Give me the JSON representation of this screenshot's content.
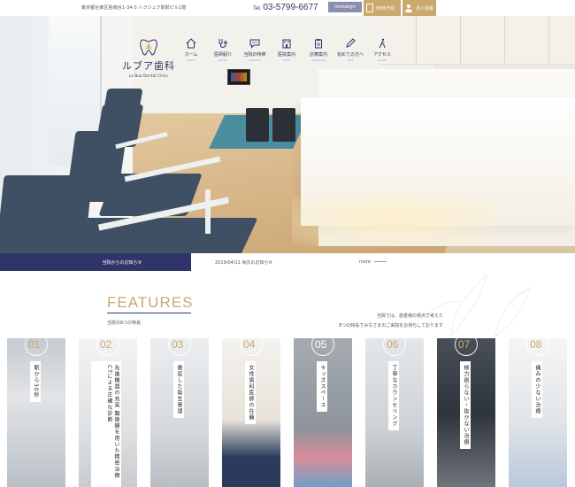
{
  "header": {
    "address": "東京都台東区柏南台1-34-3 ハラジュク駅前ビル1階",
    "tel_prefix": "Tel.",
    "tel": "03-5799-6677",
    "invisalign_label": "Invisalign",
    "web_reservation_label": "WEB予約",
    "recruit_label": "求人情報"
  },
  "logo": {
    "name": "ルブア歯科",
    "sub": "Le Bua Dental Clinic"
  },
  "nav": [
    {
      "label": "ホーム",
      "en": "Home",
      "icon": "home-icon"
    },
    {
      "label": "医師紹介",
      "en": "Doctor",
      "icon": "stethoscope-icon"
    },
    {
      "label": "当院の特徴",
      "en": "Features",
      "icon": "chat-icon"
    },
    {
      "label": "医院案内",
      "en": "Clinic",
      "icon": "building-icon"
    },
    {
      "label": "診療案内",
      "en": "Treatment",
      "icon": "clipboard-icon"
    },
    {
      "label": "初めての方へ",
      "en": "First",
      "icon": "pen-icon"
    },
    {
      "label": "アクセス",
      "en": "Access",
      "icon": "walk-icon"
    }
  ],
  "news": {
    "label": "当院からのお知らせ",
    "item": "2019/04/11 休診のお知らせ",
    "more": "more"
  },
  "features": {
    "title": "FEATURES",
    "subtitle": "当院の8つの特長",
    "desc_line1": "当院では、患者様の視点で考えた",
    "desc_line2": "8つの特長でみなさまのご来院をお待ちしております",
    "cards": [
      {
        "num": "01",
        "label": "駅から30秒",
        "bg": "#cfd4d8"
      },
      {
        "num": "02",
        "label": "先進機器の充実 顕微鏡を用いた精密治療 CTによる正確な診断",
        "bg": "#eef0f2"
      },
      {
        "num": "03",
        "label": "徹底した衛生管理",
        "bg": "#e8eaec"
      },
      {
        "num": "04",
        "label": "女性歯科医師の在籍",
        "bg": "#f4f2ef"
      },
      {
        "num": "05",
        "label": "キッズスペース",
        "bg": "#9aa0a6"
      },
      {
        "num": "06",
        "label": "丁寧なカウンセリング",
        "bg": "#dfe3e6"
      },
      {
        "num": "07",
        "label": "極力削らない・抜かない治療",
        "bg": "#3c4148"
      },
      {
        "num": "08",
        "label": "痛みの少ない治療",
        "bg": "#f1f2f3"
      }
    ]
  },
  "colors": {
    "navy": "#2f3568",
    "gold": "#c9a96e"
  }
}
